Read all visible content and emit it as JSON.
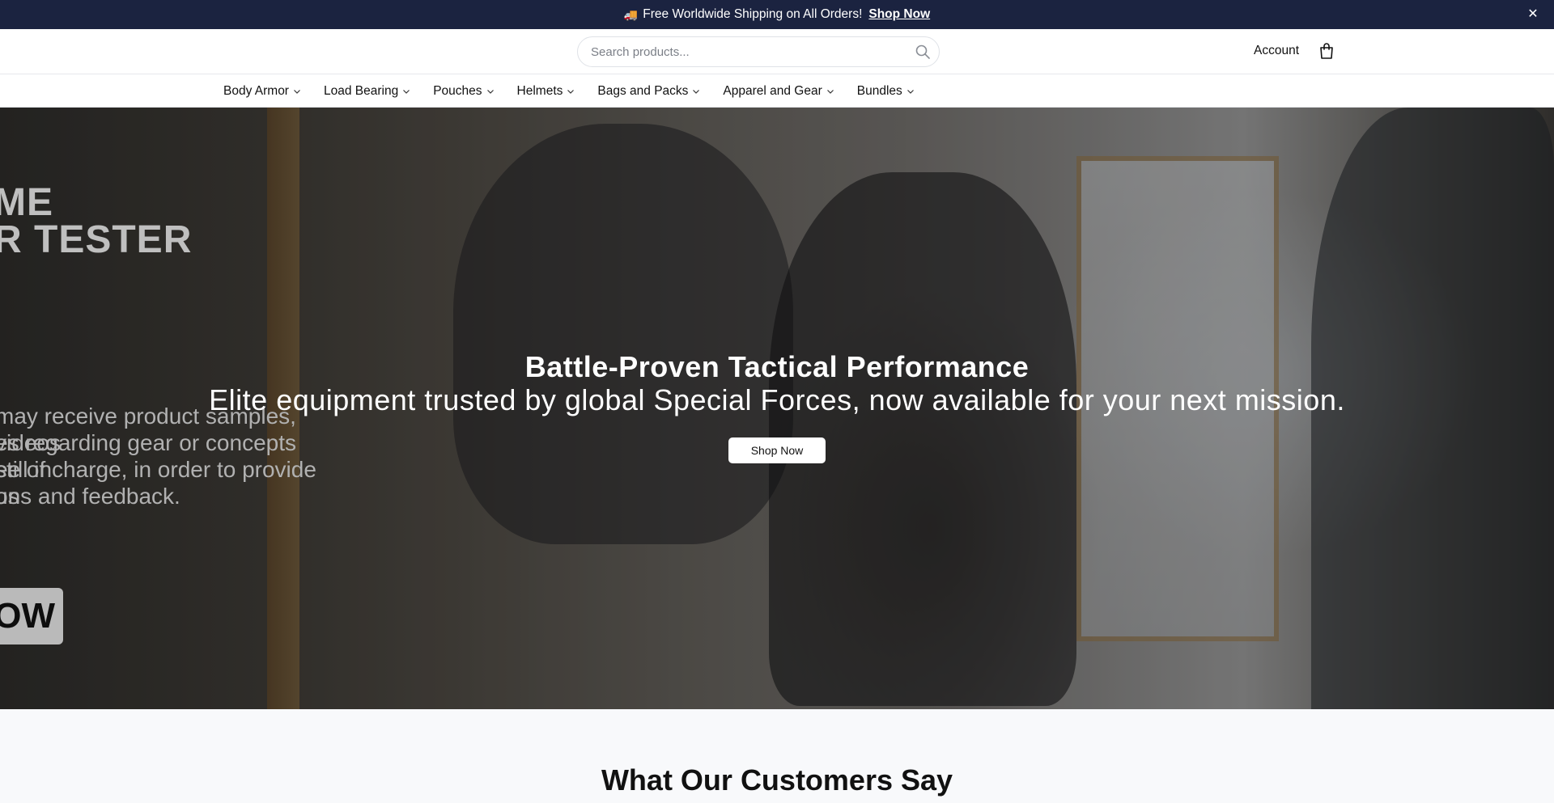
{
  "announcement": {
    "truck_emoji": "🚚",
    "text": "Free Worldwide Shipping on All Orders!",
    "link_label": "Shop Now",
    "close_glyph": "✕"
  },
  "header": {
    "search_placeholder": "Search products...",
    "account_label": "Account"
  },
  "nav": {
    "items": [
      {
        "label": "Body Armor"
      },
      {
        "label": "Load Bearing"
      },
      {
        "label": "Pouches"
      },
      {
        "label": "Helmets"
      },
      {
        "label": "Bags and Packs"
      },
      {
        "label": "Apparel and Gear"
      },
      {
        "label": "Bundles"
      }
    ]
  },
  "hero": {
    "poster_line1": "ME",
    "poster_line2": "R TESTER",
    "poster_lines": [
      "may receive product samples, videos",
      "es regarding gear or concepts still in",
      "ee of charge, in order to provide us",
      "ons and feedback."
    ],
    "poster_button": "IOW",
    "title": "Battle-Proven Tactical Performance",
    "subtitle": "Elite equipment trusted by global Special Forces, now available for your next mission.",
    "cta_label": "Shop Now"
  },
  "testimonials": {
    "title": "What Our Customers Say"
  },
  "colors": {
    "announcement_bg": "#1b2340",
    "nav_bg": "#ffffff",
    "page_bg": "#f8f9fb"
  }
}
